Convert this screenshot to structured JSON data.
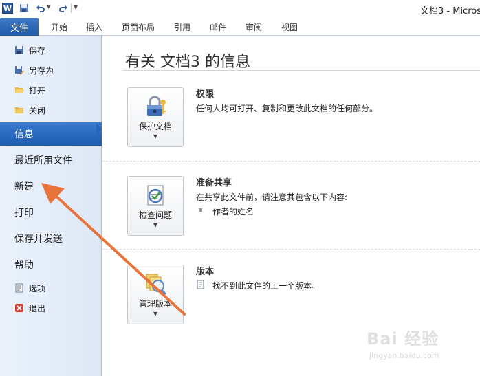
{
  "window": {
    "title": "文档3 - Micros"
  },
  "qat": {
    "app_logo": "W",
    "save_icon": "save-icon",
    "undo_icon": "undo-icon",
    "redo_icon": "redo-icon"
  },
  "tabs": {
    "file": "文件",
    "items": [
      "开始",
      "插入",
      "页面布局",
      "引用",
      "邮件",
      "审阅",
      "视图"
    ]
  },
  "nav": {
    "small_top": [
      {
        "label": "保存",
        "icon": "save-icon"
      },
      {
        "label": "另存为",
        "icon": "save-as-icon"
      },
      {
        "label": "打开",
        "icon": "open-folder-icon"
      },
      {
        "label": "关闭",
        "icon": "close-folder-icon"
      }
    ],
    "big": [
      "信息",
      "最近所用文件",
      "新建",
      "打印",
      "保存并发送",
      "帮助"
    ],
    "active": "信息",
    "small_bottom": [
      {
        "label": "选项",
        "icon": "options-icon"
      },
      {
        "label": "退出",
        "icon": "exit-icon"
      }
    ]
  },
  "main": {
    "title": "有关 文档3 的信息",
    "sections": [
      {
        "button_label": "保护文档",
        "icon": "lock-key-icon",
        "title": "权限",
        "text": "任何人均可打开、复制和更改此文档的任何部分。"
      },
      {
        "button_label": "检查问题",
        "icon": "checklist-icon",
        "title": "准备共享",
        "text": "在共享此文件前，请注意其包含以下内容:",
        "bullet": "作者的姓名"
      },
      {
        "button_label": "管理版本",
        "icon": "versions-icon",
        "title": "版本",
        "text": "找不到此文件的上一个版本。"
      }
    ]
  },
  "watermark": {
    "logo": "Bai 经验",
    "url": "jingyan.baidu.com"
  },
  "colors": {
    "accent": "#2468bd",
    "annotation_arrow": "#e8743b"
  }
}
